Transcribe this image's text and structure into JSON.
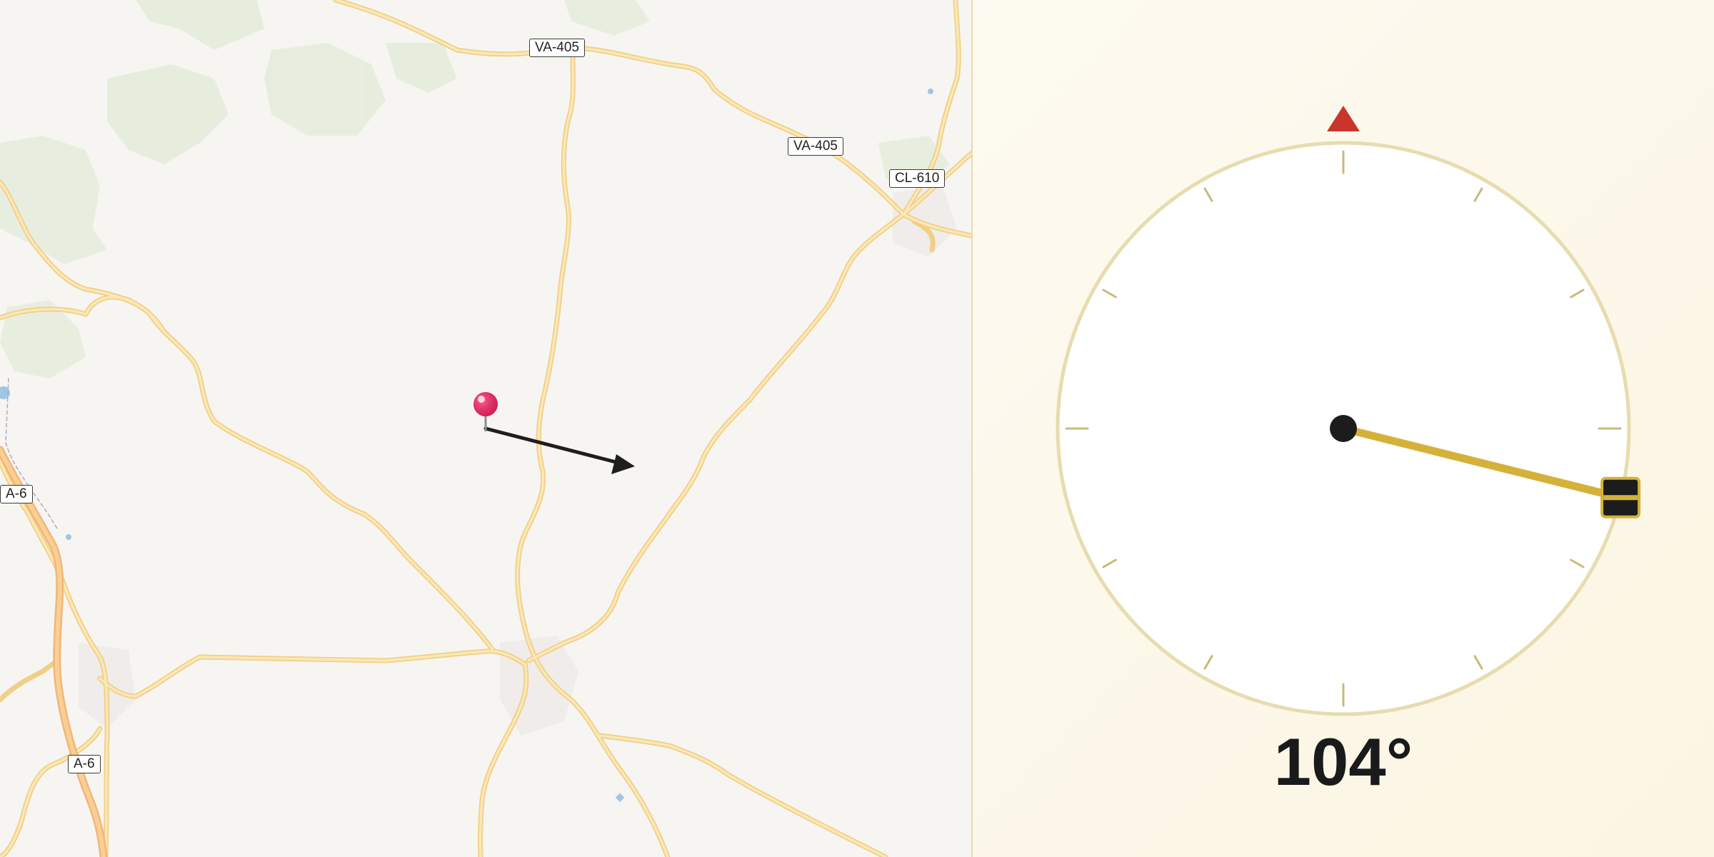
{
  "map": {
    "road_labels": [
      "VA-405",
      "VA-405",
      "CL-610",
      "A-6",
      "A-6"
    ],
    "pin_icon": "map-pin-icon",
    "direction_arrow_icon": "direction-arrow-icon"
  },
  "compass": {
    "heading_degrees": 104,
    "heading_text": "104°",
    "north_marker_icon": "north-triangle-icon",
    "colors": {
      "ring": "#e6dcae",
      "needle": "#d4b23a",
      "north_marker": "#c9352c",
      "hub": "#1c1c1c"
    }
  }
}
